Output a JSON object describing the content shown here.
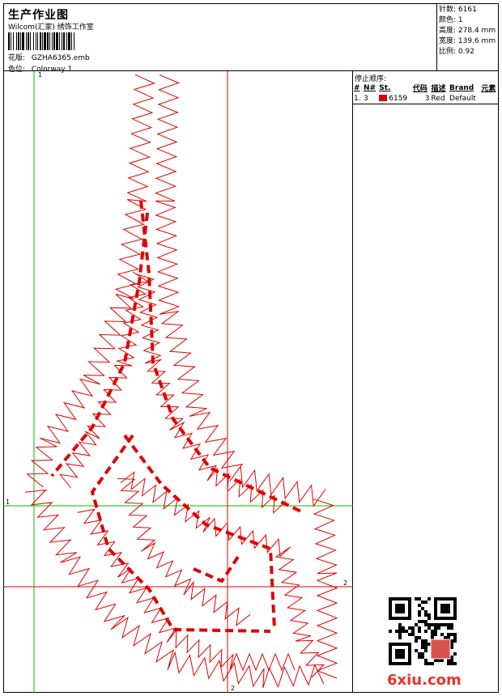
{
  "header": {
    "title": "生产作业图",
    "studio": "Wilcom(汇家) 绣饰工作室",
    "design_label": "花版:",
    "design_value": "GZHA6365.emb",
    "colorway_label": "色位:",
    "colorway_value": "Colorway 1"
  },
  "stats": [
    {
      "label": "针数:",
      "value": "6161"
    },
    {
      "label": "颜色:",
      "value": "1"
    },
    {
      "label": "高度:",
      "value": "278.4 mm"
    },
    {
      "label": "宽度:",
      "value": "139.6 mm"
    },
    {
      "label": "比例:",
      "value": "0.92"
    }
  ],
  "stop_sequence": {
    "title": "停止顺序:",
    "columns": [
      "#",
      "N#",
      "St.",
      "代码",
      "描述",
      "Brand",
      "元素"
    ],
    "rows": [
      {
        "index": "1.",
        "needle": "3",
        "color": "#e00000",
        "code": "6159",
        "st": "3",
        "desc": "Red",
        "brand": "Default"
      }
    ]
  },
  "canvas": {
    "axis_labels": [
      "1",
      "1",
      "2",
      "2"
    ],
    "stitch_color": "#e00000",
    "guide_green": "#00c000",
    "guide_red": "#e00000"
  },
  "watermark": "6xiu.com"
}
